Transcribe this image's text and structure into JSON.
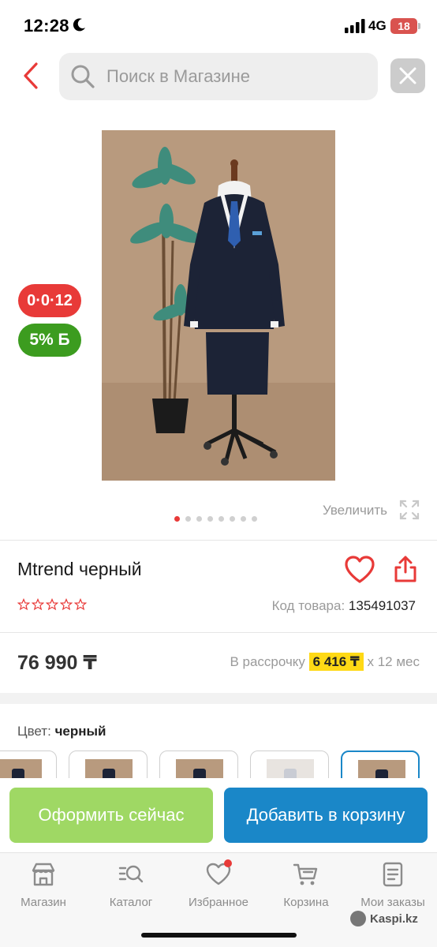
{
  "status_bar": {
    "time": "12:28",
    "network": "4G",
    "battery": "18"
  },
  "search": {
    "placeholder": "Поиск в Магазине"
  },
  "product": {
    "badge_installment": "0·0·12",
    "badge_bonus": "5% Б",
    "zoom_label": "Увеличить",
    "image_pager": {
      "total": 8,
      "active": 1
    },
    "title": "Mtrend черный",
    "rating_stars": 0,
    "code_label": "Код товара:",
    "code_value": "135491037",
    "price": "76 990 ₸",
    "installment_prefix": "В рассрочку",
    "installment_amount": "6 416 ₸",
    "installment_suffix": "x 12 мес",
    "color_label": "Цвет:",
    "color_value": "черный"
  },
  "actions": {
    "checkout_label": "Оформить сейчас",
    "add_to_cart_label": "Добавить в корзину"
  },
  "bottom_nav": {
    "items": [
      {
        "label": "Магазин",
        "icon": "shop-icon"
      },
      {
        "label": "Каталог",
        "icon": "catalog-search-icon"
      },
      {
        "label": "Избранное",
        "icon": "heart-icon"
      },
      {
        "label": "Корзина",
        "icon": "cart-icon"
      },
      {
        "label": "Мои заказы",
        "icon": "orders-icon"
      }
    ]
  },
  "watermark": "Kaspi.kz",
  "colors": {
    "accent_red": "#e83a38",
    "bonus_green": "#3c9c1f",
    "checkout_green": "#9fd864",
    "cart_blue": "#1a87c8",
    "installment_yellow": "#ffd915"
  }
}
